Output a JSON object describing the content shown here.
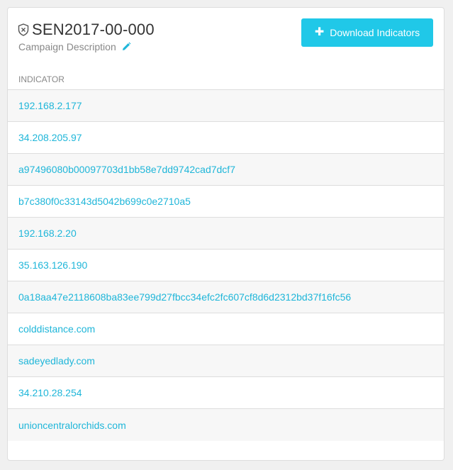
{
  "campaign": {
    "title": "SEN2017-00-000",
    "description": "Campaign Description",
    "icon": "shield-icon",
    "edit_icon": "pencil-icon"
  },
  "toolbar": {
    "download_label": "Download Indicators",
    "download_icon": "plus-icon"
  },
  "table": {
    "column_header": "INDICATOR",
    "rows": [
      "192.168.2.177",
      "34.208.205.97",
      "a97496080b00097703d1bb58e7dd9742cad7dcf7",
      "b7c380f0c33143d5042b699c0e2710a5",
      "192.168.2.20",
      "35.163.126.190",
      "0a18aa47e2118608ba83ee799d27fbcc34efc2fc607cf8d6d2312bd37f16fc56",
      "colddistance.com",
      "sadeyedlady.com",
      "34.210.28.254",
      "unioncentralorchids.com"
    ]
  },
  "colors": {
    "accent": "#20c8e8",
    "link": "#1fb6d9",
    "muted": "#888888",
    "row_alt": "#f7f7f7",
    "border": "#dddddd"
  }
}
